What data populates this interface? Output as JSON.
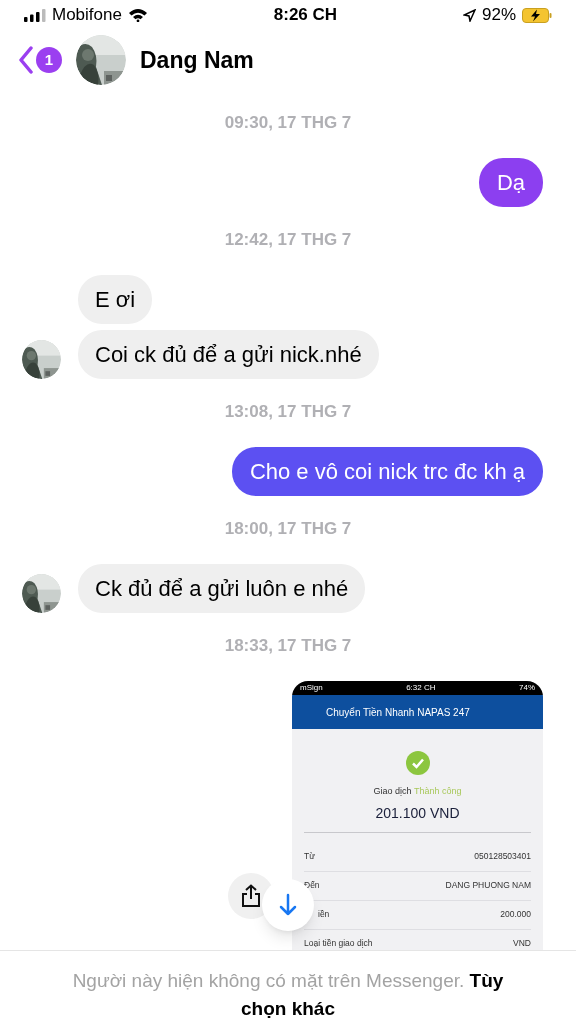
{
  "status_bar": {
    "carrier": "Mobifone",
    "time": "8:26 CH",
    "battery": "92%"
  },
  "header": {
    "back_badge": "1",
    "name": "Dang Nam"
  },
  "messages": [
    {
      "kind": "timestamp",
      "text": "09:30, 17 THG 7"
    },
    {
      "kind": "sent",
      "text": "Dạ",
      "color": "#8c3ff0"
    },
    {
      "kind": "timestamp",
      "text": "12:42, 17 THG 7"
    },
    {
      "kind": "received",
      "text": "E ơi",
      "avatar": false
    },
    {
      "kind": "received",
      "text": "Coi ck đủ để a gửi nick.nhé",
      "avatar": true
    },
    {
      "kind": "timestamp",
      "text": "13:08, 17 THG 7"
    },
    {
      "kind": "sent",
      "text": "Cho e vô coi nick trc đc kh ạ",
      "color": "#5c50f2"
    },
    {
      "kind": "timestamp",
      "text": "18:00, 17 THG 7"
    },
    {
      "kind": "received",
      "text": "Ck đủ để a gửi luôn e nhé",
      "avatar": true
    },
    {
      "kind": "timestamp",
      "text": "18:33, 17 THG 7"
    },
    {
      "receipt": {
        "carrier": "mSign",
        "time": "6:32 CH",
        "battery": "74%",
        "title": "Chuyển Tiền Nhanh NAPAS 247",
        "status_prefix": "Giao dịch",
        "status": "Thành công",
        "amount": "201.100 VND",
        "rows": [
          {
            "label": "Từ",
            "value": "050128503401"
          },
          {
            "label": "Đến",
            "value": "DANG PHUONG NAM"
          },
          {
            "label": "iền",
            "value": "200.000"
          },
          {
            "label": "Loại tiền giao dịch",
            "value": "VND"
          }
        ]
      }
    }
  ],
  "footer": {
    "text": "Người này hiện không có mặt trên Messenger. **Tùy chọn khác**"
  }
}
